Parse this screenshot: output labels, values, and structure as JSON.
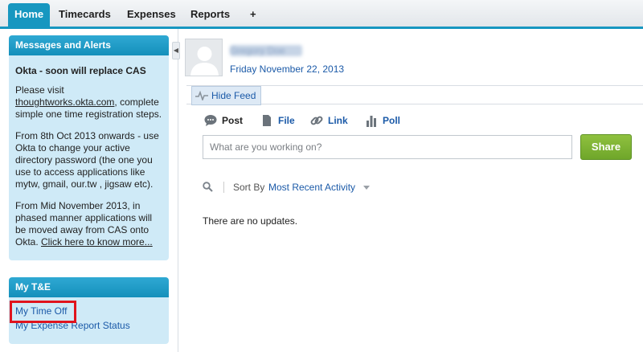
{
  "tabs": [
    {
      "label": "Home",
      "active": true
    },
    {
      "label": "Timecards"
    },
    {
      "label": "Expenses"
    },
    {
      "label": "Reports"
    },
    {
      "label": "+"
    }
  ],
  "messages": {
    "header": "Messages and Alerts",
    "title": "Okta - soon will replace CAS",
    "p1_pre": "Please visit ",
    "p1_link": "thoughtworks.okta.com",
    "p1_post": ", complete simple one time registration steps.",
    "p2": "From 8th Oct 2013 onwards - use Okta to change your active directory password (the one you use to access applications like mytw, gmail, our.tw , jigsaw etc).",
    "p3_pre": "From Mid November 2013, in phased manner applications will be moved away from CAS onto Okta. ",
    "p3_link": "Click here to know more..."
  },
  "te": {
    "header": "My T&E",
    "links": [
      "My Time Off",
      "My Expense Report Status"
    ]
  },
  "profile": {
    "name": "Gregory Doe",
    "date": "Friday November 22, 2013"
  },
  "feed": {
    "hide_label": "Hide Feed",
    "publisher_tabs": [
      "Post",
      "File",
      "Link",
      "Poll"
    ],
    "placeholder": "What are you working on?",
    "share_label": "Share",
    "sort_label": "Sort By",
    "sort_value": "Most Recent Activity",
    "empty_text": "There are no updates."
  },
  "colors": {
    "accent": "#1797c0",
    "panel_bg": "#cfeaf7",
    "link": "#1b5aa8",
    "share_green": "#7ab232",
    "highlight_red": "#e0141d"
  }
}
